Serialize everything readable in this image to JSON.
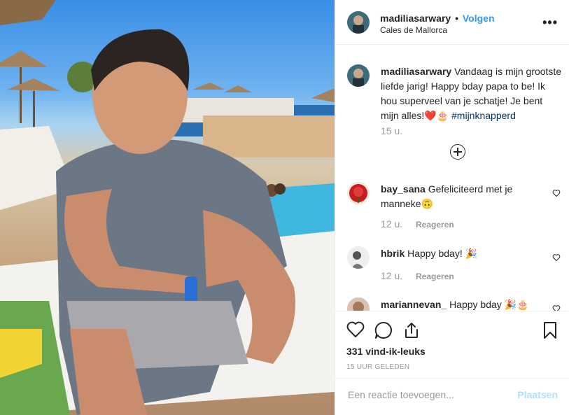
{
  "post": {
    "username": "madiliasarwary",
    "follow_label": "Volgen",
    "location": "Cales de Mallorca",
    "more_icon": "more-horizontal-icon"
  },
  "caption": {
    "username": "madiliasarwary",
    "text": "Vandaag is mijn grootste liefde jarig! Happy bday papa to be! Ik hou superveel van je schatje! Je bent mijn alles!",
    "emoji": "❤️🎂",
    "hashtag": "#mijnknapperd",
    "time": "15 u."
  },
  "comments": [
    {
      "username": "bay_sana",
      "text": "Gefeliciteerd met je manneke🙃",
      "time": "12 u.",
      "reply_label": "Reageren"
    },
    {
      "username": "hbrik",
      "text": "Happy bday! 🎉",
      "time": "12 u.",
      "reply_label": "Reageren"
    },
    {
      "username": "mariannevan_",
      "text": "Happy bday 🎉🎂",
      "time": "",
      "reply_label": ""
    }
  ],
  "actions": {
    "likes": "331 vind-ik-leuks",
    "posted_ago": "15 UUR GELEDEN",
    "icons": [
      "heart-icon",
      "comment-icon",
      "share-icon",
      "bookmark-icon"
    ]
  },
  "add_comment": {
    "placeholder": "Een reactie toevoegen...",
    "post_label": "Plaatsen"
  },
  "colors": {
    "link": "#3897f0",
    "muted": "#999999",
    "post_disabled": "#b2dffc",
    "hashtag": "#003569"
  }
}
